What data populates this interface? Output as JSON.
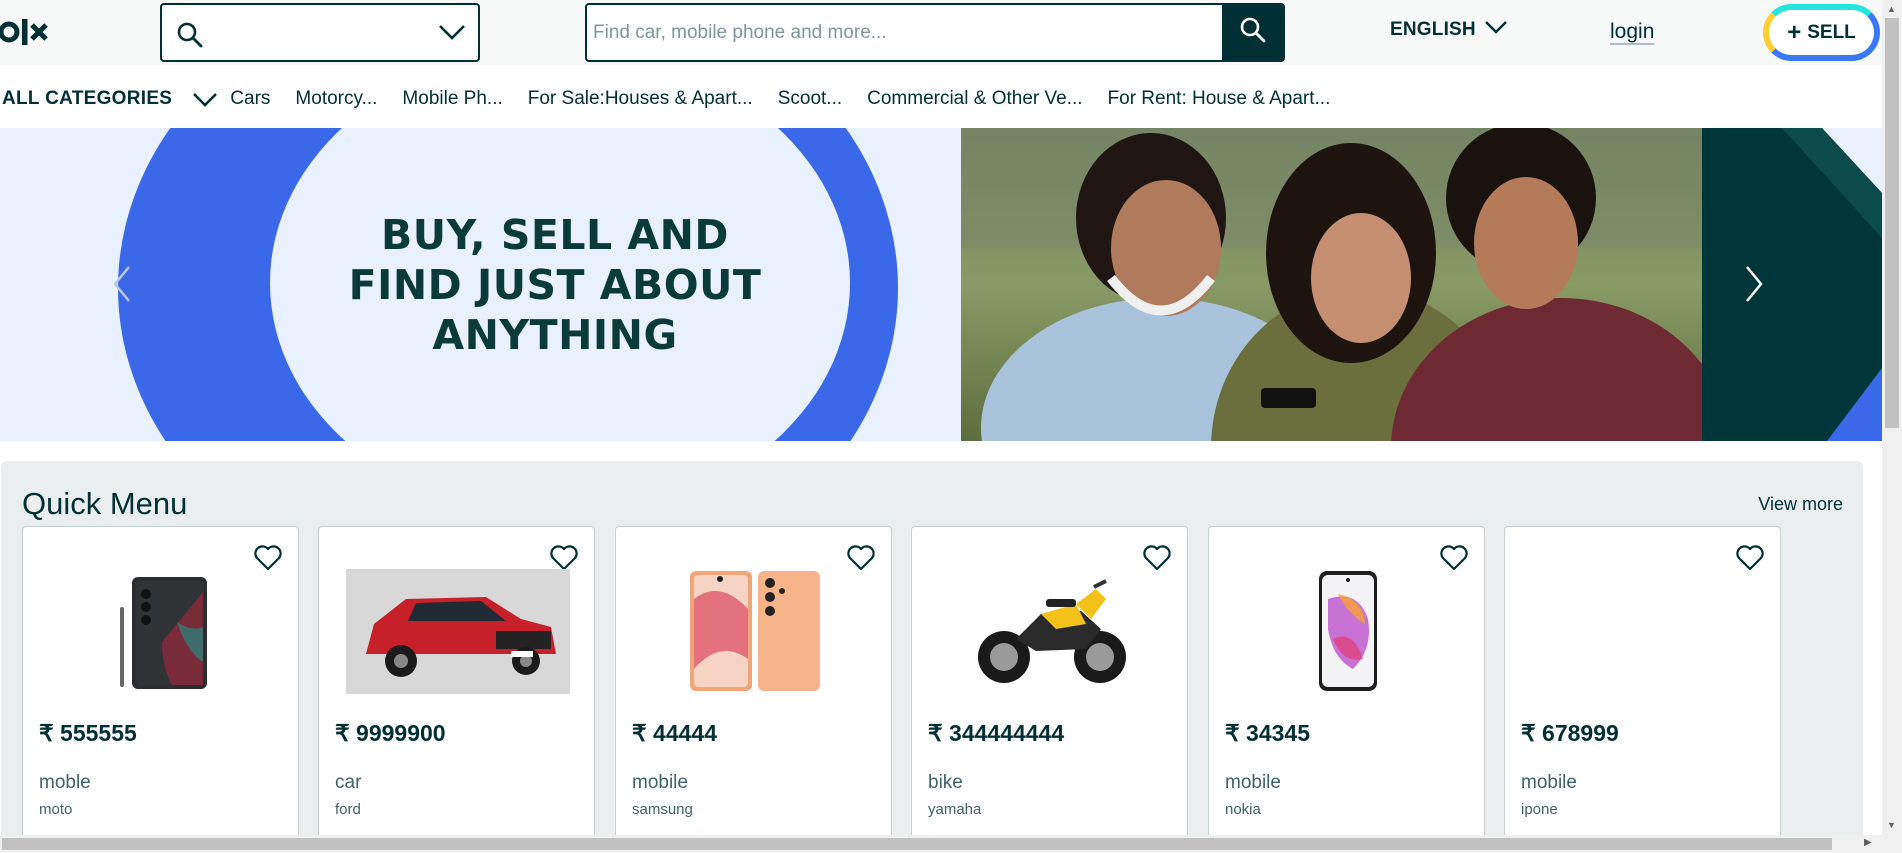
{
  "header": {
    "logo_text": "OLX",
    "location_value": "",
    "search_placeholder": "Find car, mobile phone and more...",
    "language": "ENGLISH",
    "login": "login",
    "sell": "SELL",
    "sell_plus": "+"
  },
  "categories": {
    "all_label": "ALL CATEGORIES",
    "items": [
      "Cars",
      "Motorcy...",
      "Mobile Ph...",
      "For Sale:Houses & Apart...",
      "Scoot...",
      "Commercial & Other Ve...",
      "For Rent: House & Apart..."
    ]
  },
  "banner": {
    "headline_line1": "BUY, SELL AND",
    "headline_line2": "FIND JUST ABOUT",
    "headline_line3": "ANYTHING",
    "colors": {
      "blue": "#3a68e8",
      "light": "#e9f1ff",
      "dark_green": "#00363a"
    }
  },
  "quick_menu": {
    "title": "Quick Menu",
    "view_more": "View more",
    "cards": [
      {
        "price": "₹ 555555",
        "title": "moble",
        "sub": "moto",
        "image": "smartphone-dark-stylus"
      },
      {
        "price": "₹ 9999900",
        "title": "car",
        "sub": "ford",
        "image": "red-suv"
      },
      {
        "price": "₹ 44444",
        "title": "mobile",
        "sub": "samsung",
        "image": "smartphone-pair-peach"
      },
      {
        "price": "₹ 344444444",
        "title": "bike",
        "sub": "yamaha",
        "image": "yellow-motorcycle"
      },
      {
        "price": "₹ 34345",
        "title": "mobile",
        "sub": "nokia",
        "image": "smartphone-colorful"
      },
      {
        "price": "₹ 678999",
        "title": "mobile",
        "sub": "ipone",
        "image": ""
      }
    ]
  },
  "colors": {
    "brand_dark": "#002f34",
    "sell_ring_yellow": "#ffce32",
    "sell_ring_cyan": "#23e5db",
    "sell_ring_blue": "#3a77ff"
  }
}
